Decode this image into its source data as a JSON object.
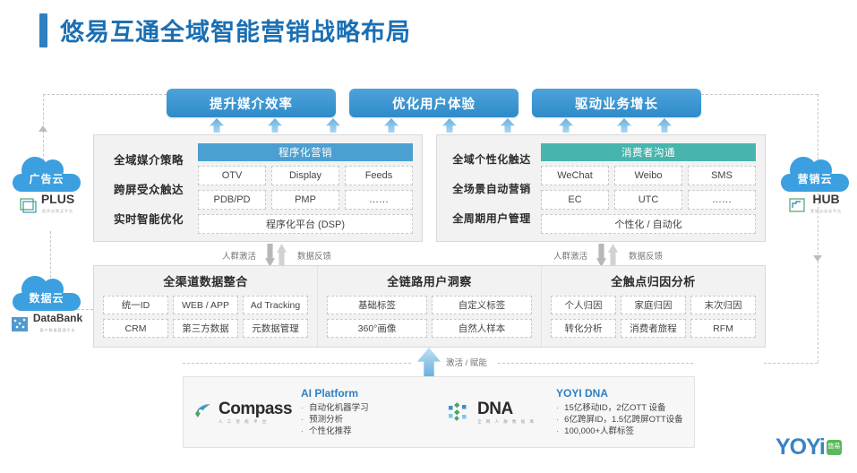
{
  "page": {
    "title": "悠易互通全域智能营销战略布局"
  },
  "goals": [
    {
      "label": "提升媒介效率"
    },
    {
      "label": "优化用户体验"
    },
    {
      "label": "驱动业务增长"
    }
  ],
  "left_panel": {
    "row_labels": [
      "全域媒介策略",
      "跨屏受众触达",
      "实时智能优化"
    ],
    "caption": "程序化营销",
    "row1": [
      "OTV",
      "Display",
      "Feeds"
    ],
    "row2": [
      "PDB/PD",
      "PMP",
      "……"
    ],
    "row3": [
      "程序化平台 (DSP)"
    ]
  },
  "right_panel": {
    "row_labels": [
      "全域个性化触达",
      "全场景自动营销",
      "全周期用户管理"
    ],
    "caption": "消费者沟通",
    "row1": [
      "WeChat",
      "Weibo",
      "SMS"
    ],
    "row2": [
      "EC",
      "UTC",
      "……"
    ],
    "row3": [
      "个性化 / 自动化"
    ]
  },
  "exchange": {
    "left": {
      "activate": "人群激活",
      "feedback": "数据反馈"
    },
    "right": {
      "activate": "人群激活",
      "feedback": "数据反馈"
    }
  },
  "data_panel": {
    "sections": [
      {
        "title": "全渠道数据整合",
        "cells": [
          "统一ID",
          "WEB / APP",
          "Ad Tracking",
          "CRM",
          "第三方数据",
          "元数据管理"
        ]
      },
      {
        "title": "全链路用户洞察",
        "cells": [
          "基础标签",
          "自定义标签",
          "360°画像",
          "自然人样本"
        ]
      },
      {
        "title": "全触点归因分析",
        "cells": [
          "个人归因",
          "家庭归因",
          "末次归因",
          "转化分析",
          "消费者旅程",
          "RFM"
        ]
      }
    ]
  },
  "activation": {
    "label": "激活 / 赋能"
  },
  "platforms": [
    {
      "logo_name": "Compass",
      "logo_sub": "人 工 智 能 平 台",
      "title": "AI Platform",
      "bullets": [
        "自动化机器学习",
        "预测分析",
        "个性化推荐"
      ]
    },
    {
      "logo_name": "DNA",
      "logo_sub": "全 网 人 群 数 据 库",
      "title": "YOYI DNA",
      "bullets": [
        "15亿移动ID，2亿OTT 设备",
        "6亿跨屏ID，1.5亿跨屏OTT设备",
        "100,000+人群标签"
      ]
    }
  ],
  "clouds": {
    "ad": {
      "name": "广告云",
      "product": "PLUS",
      "product_sub": "程序化购买平台"
    },
    "data": {
      "name": "数据云",
      "product": "DataBank",
      "product_sub": "客户数据管理平台"
    },
    "marketing": {
      "name": "营销云",
      "product": "HUB",
      "product_sub": "营销自动化平台"
    }
  },
  "brand": {
    "logo_text": "YOYi",
    "logo_badge": "悠易"
  },
  "colors": {
    "title_blue": "#1b6fb3",
    "pill_blue": "#2e8bc9",
    "caption_blue": "#4ba0d1",
    "caption_teal": "#48b4ae",
    "cloud_blue": "#3b9fe0",
    "panel_bg": "#f2f2f2",
    "accent_green": "#5cb85c"
  }
}
